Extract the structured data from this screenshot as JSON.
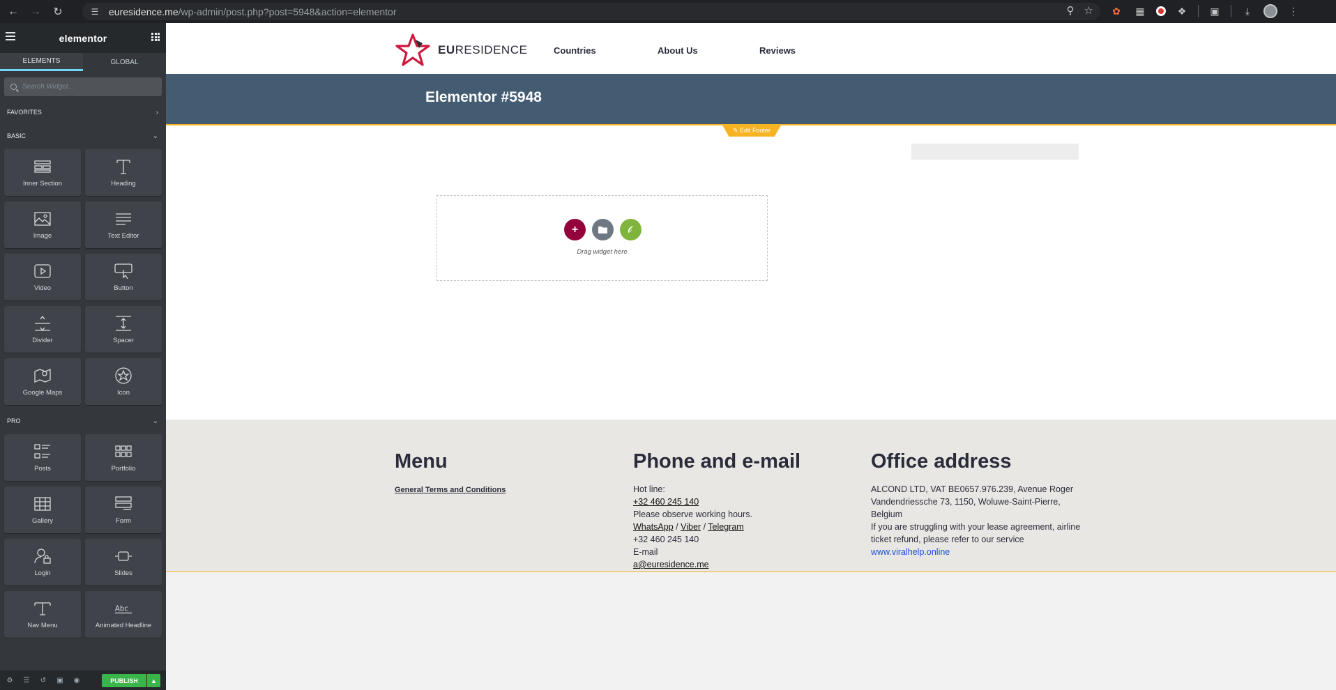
{
  "browser": {
    "url_host": "euresidence.me",
    "url_path": "/wp-admin/post.php?post=5948&action=elementor"
  },
  "panel": {
    "logo": "elementor",
    "tabs": [
      {
        "label": "ELEMENTS"
      },
      {
        "label": "GLOBAL"
      }
    ],
    "search_placeholder": "Search Widget...",
    "categories": {
      "favorites": "FAVORITES",
      "basic": "BASIC",
      "pro": "PRO"
    },
    "basic_widgets": [
      {
        "label": "Inner Section",
        "icon": "inner-section-icon"
      },
      {
        "label": "Heading",
        "icon": "heading-icon"
      },
      {
        "label": "Image",
        "icon": "image-icon"
      },
      {
        "label": "Text Editor",
        "icon": "text-editor-icon"
      },
      {
        "label": "Video",
        "icon": "video-icon"
      },
      {
        "label": "Button",
        "icon": "button-icon"
      },
      {
        "label": "Divider",
        "icon": "divider-icon"
      },
      {
        "label": "Spacer",
        "icon": "spacer-icon"
      },
      {
        "label": "Google Maps",
        "icon": "google-maps-icon"
      },
      {
        "label": "Icon",
        "icon": "star-icon"
      }
    ],
    "pro_widgets": [
      {
        "label": "Posts",
        "icon": "posts-icon"
      },
      {
        "label": "Portfolio",
        "icon": "portfolio-icon"
      },
      {
        "label": "Gallery",
        "icon": "gallery-icon"
      },
      {
        "label": "Form",
        "icon": "form-icon"
      },
      {
        "label": "Login",
        "icon": "login-icon"
      },
      {
        "label": "Slides",
        "icon": "slides-icon"
      },
      {
        "label": "Nav Menu",
        "icon": "nav-menu-icon"
      },
      {
        "label": "Animated Headline",
        "icon": "animated-headline-icon"
      }
    ],
    "publish_label": "PUBLISH"
  },
  "site": {
    "logo_bold": "EU",
    "logo_rest": "RESIDENCE",
    "menu": [
      "Countries",
      "About Us",
      "Reviews"
    ],
    "page_title": "Elementor #5948",
    "edit_footer_label": "Edit Footer",
    "drop_zone_text": "Drag widget here"
  },
  "footer": {
    "menu": {
      "heading": "Menu",
      "link": "General Terms and Conditions"
    },
    "contact": {
      "heading": "Phone and e-mail",
      "hotline_label": "Hot line:",
      "hotline_number": "+32 460 245 140",
      "hours_note": "Please observe working hours.",
      "messengers": [
        "WhatsApp",
        "Viber",
        "Telegram"
      ],
      "messenger_number": "+32 460 245 140",
      "email_label": "E-mail",
      "email": "a@euresidence.me"
    },
    "office": {
      "heading": "Office address",
      "line1": "ALCOND LTD, VAT BE0657.976.239, Avenue Roger",
      "line2": "Vandendriessche 73, 1150, Woluwe-Saint-Pierre,",
      "line3": "Belgium",
      "line4": "If you are struggling with your lease agreement, airline",
      "line5": "ticket refund, please refer to our service",
      "link": "www.viralhelp.online"
    }
  },
  "colors": {
    "accent": "#f6b322",
    "hero": "#445c72",
    "publish": "#39b54a",
    "logo_star": "#d0183c"
  }
}
